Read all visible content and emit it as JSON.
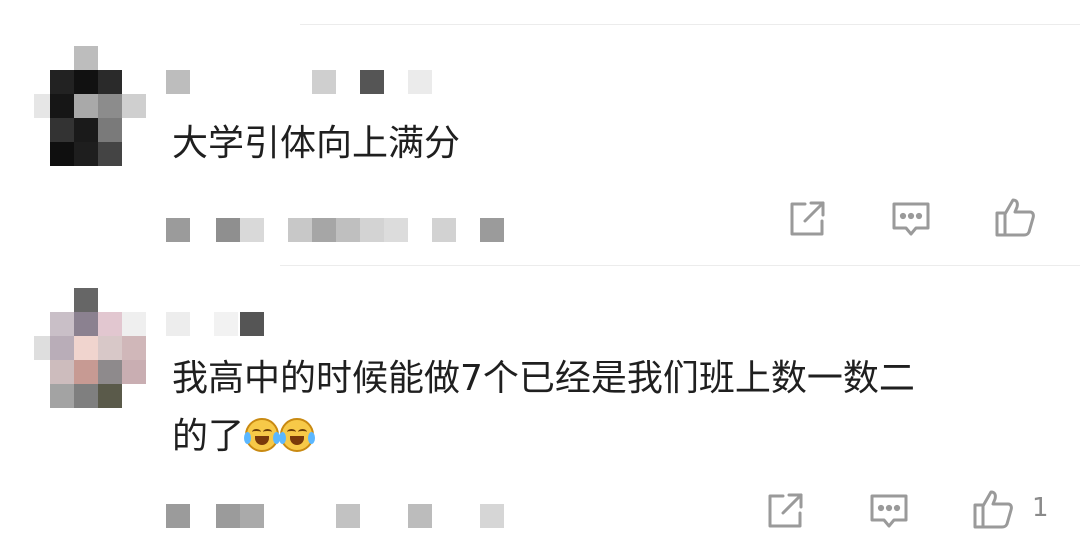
{
  "colors": {
    "text": "#1f1f1f",
    "icon": "#9a9a9a",
    "divider": "#ececec",
    "emoji_face": "#f7c948"
  },
  "comments": [
    {
      "text_lines": [
        "大学引体向上满分"
      ],
      "share_icon": "share-icon",
      "reply_icon": "comment-icon",
      "like_icon": "thumbs-up-icon",
      "like_count": ""
    },
    {
      "text_lines": [
        "我高中的时候能做7个已经是我们班上数一数二",
        "的了"
      ],
      "emojis": [
        "laugh-cry-emoji",
        "laugh-cry-emoji"
      ],
      "share_icon": "share-icon",
      "reply_icon": "comment-icon",
      "like_icon": "thumbs-up-icon",
      "like_count": "1"
    }
  ]
}
